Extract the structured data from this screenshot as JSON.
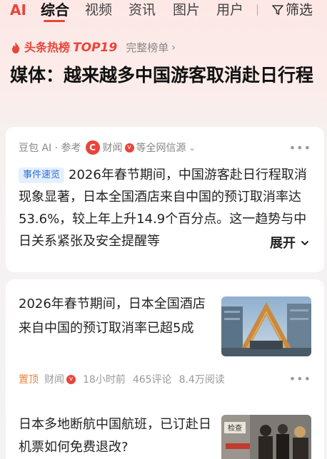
{
  "tabs": {
    "ai": "AI",
    "items": [
      "综合",
      "视频",
      "资讯",
      "图片",
      "用户"
    ],
    "filter": "筛选"
  },
  "hot": {
    "title": "头条热榜",
    "top": "TOP19",
    "full_list": "完整榜单"
  },
  "headline": "媒体：越来越多中国游客取消赴日行程",
  "card_ai": {
    "source": "豆包 AI · 参考",
    "ref_name": "财闻",
    "ref_suffix": "等全网信源",
    "tag": "事件速览",
    "summary": "2026年春节期间，中国游客赴日行程取消现象显著，日本全国酒店来自中国的预订取消率达53.6%，较上年上升14.9个百分点。这一趋势与中日关系紧张及安全提醒等",
    "expand": "展开"
  },
  "news": [
    {
      "title": "2026年春节期间，日本全国酒店来自中国的预订取消率已超5成",
      "pin": "置顶",
      "source": "财闻",
      "time": "18小时前",
      "comments": "465评论",
      "reads": "8.4万阅读"
    },
    {
      "title": "日本多地断航中国航班，已订赴日机票如何免费退改?",
      "thumb_sign": "检查"
    }
  ],
  "colors": {
    "accent": "#e8453a",
    "tag_bg": "#e6f0fd",
    "tag_text": "#2f6fd6",
    "pin": "#e8843a"
  }
}
